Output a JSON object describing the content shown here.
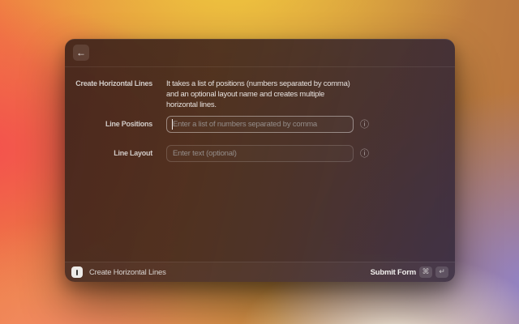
{
  "window": {
    "header": {
      "back_icon": "←"
    },
    "form": {
      "title_label": "Create Horizontal Lines",
      "description": "It takes a list of positions (numbers separated by comma) and an optional layout name and creates multiple horizontal lines.",
      "fields": [
        {
          "label": "Line Positions",
          "placeholder": "Enter a list of numbers separated by comma",
          "value": "",
          "info_icon": "ⓘ",
          "focused": "true"
        },
        {
          "label": "Line Layout",
          "placeholder": "Enter text (optional)",
          "value": "",
          "info_icon": "ⓘ",
          "focused": "false"
        }
      ]
    },
    "footer": {
      "command_name": "Create Horizontal Lines",
      "submit_label": "Submit Form",
      "shortcut": {
        "modifier_key": "⌘",
        "return_key": "↵"
      }
    }
  },
  "colors": {
    "window_bg": "#3e241b",
    "wallpaper_yellow": "#f0c53e",
    "wallpaper_red": "#f4514d",
    "wallpaper_orange": "#f07a43",
    "wallpaper_salmon": "#f58a67",
    "wallpaper_cream": "#f8eedd",
    "wallpaper_purple": "#9183cb",
    "focused_border": "rgba(255,255,255,0.42)"
  }
}
